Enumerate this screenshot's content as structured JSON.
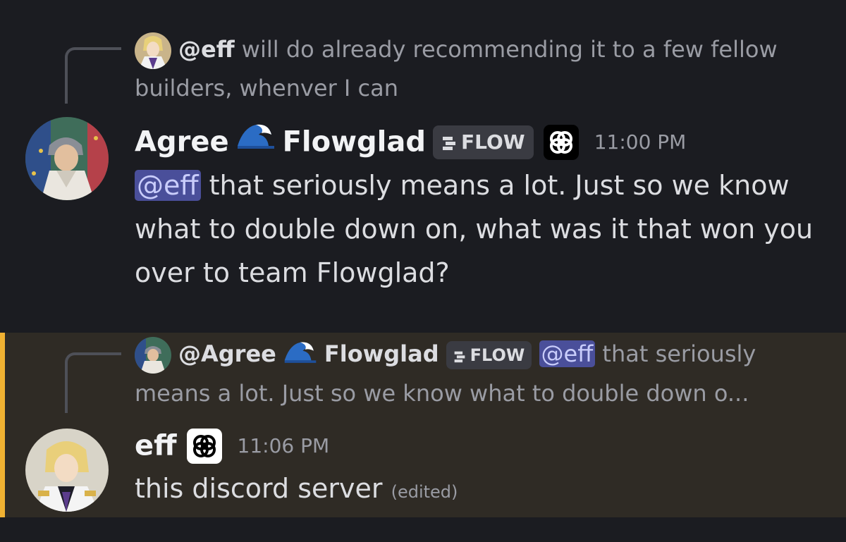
{
  "message1": {
    "reply": {
      "author": "@eff",
      "text": "will do already recommending it to a few fellow builders, whenver I can"
    },
    "author": "Agree",
    "server": "Flowglad",
    "tag": "FLOW",
    "timestamp": "11:00 PM",
    "mention": "@eff",
    "text": "that seriously means a lot. Just so we know what to double down on, what was it that won you over to team Flowglad?"
  },
  "message2": {
    "reply": {
      "author": "@Agree",
      "server": "Flowglad",
      "tag": "FLOW",
      "mention": "@eff",
      "text_line1": "that seriously",
      "text_line2": "means a lot. Just so we know what to double down o..."
    },
    "author": "eff",
    "timestamp": "11:06 PM",
    "text": "this discord server",
    "edited": "(edited)"
  },
  "colors": {
    "background": "#1b1c21",
    "highlight_bg": "#2f2b25",
    "mention_bar": "#f0b132",
    "mention_bg": "#4a4f9a"
  },
  "icons": [
    "wave-emoji-icon",
    "flow-tag-icon",
    "interlock-badge-icon"
  ]
}
